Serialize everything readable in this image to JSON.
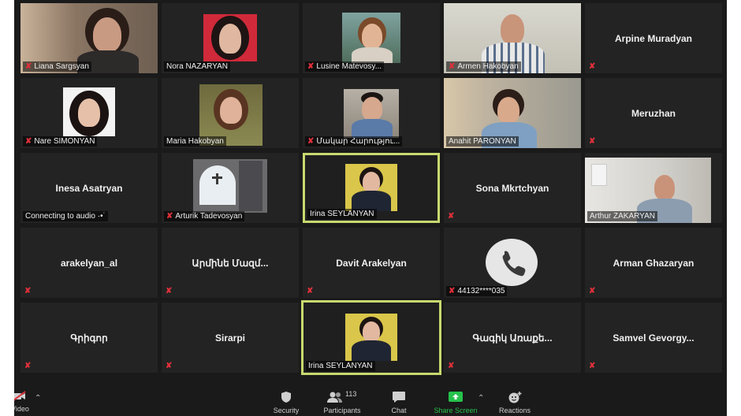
{
  "participants": [
    {
      "name": "Liana Sargsyan",
      "muted": true
    },
    {
      "name": "Nora NAZARYAN",
      "muted": false
    },
    {
      "name": "Lusine Matevosy...",
      "muted": true
    },
    {
      "name": "Armen Hakobyan",
      "muted": true
    },
    {
      "name": "Arpine Muradyan",
      "muted": true
    },
    {
      "name": "Nare SIMONYAN",
      "muted": true
    },
    {
      "name": "Maria Hakobyan",
      "muted": false
    },
    {
      "name": "Մակար Հարությու...",
      "muted": true
    },
    {
      "name": "Anahit PARONYAN",
      "muted": false
    },
    {
      "name": "Meruzhan",
      "muted": true
    },
    {
      "name": "Inesa Asatryan",
      "status": "Connecting to audio",
      "muted": false
    },
    {
      "name": "Arturik Tadevosyan",
      "muted": true
    },
    {
      "name": "Irina SEYLANYAN",
      "muted": false
    },
    {
      "name": "Sona Mkrtchyan",
      "muted": true
    },
    {
      "name": "Arthur ZAKARYAN",
      "muted": false
    },
    {
      "name": "arakelyan_al",
      "muted": true
    },
    {
      "name": "Արմինե Մազմ...",
      "muted": true
    },
    {
      "name": "Davit Arakelyan",
      "muted": true
    },
    {
      "name": "44132****035",
      "muted": true
    },
    {
      "name": "Arman Ghazaryan",
      "muted": true
    },
    {
      "name": "Գրիգոր",
      "muted": true
    },
    {
      "name": "Sirarpi",
      "muted": true
    },
    {
      "name": "Irina SEYLANYAN",
      "muted": false
    },
    {
      "name": "Գագիկ Առաքե...",
      "muted": true
    },
    {
      "name": "Samvel  Gevorgy...",
      "muted": true
    }
  ],
  "toolbar": {
    "video_label": "Video",
    "security_label": "Security",
    "participants_label": "Participants",
    "participants_count": "113",
    "chat_label": "Chat",
    "share_label": "Share Screen",
    "reactions_label": "Reactions"
  },
  "colors": {
    "accent": "#27c24c",
    "active_border": "#c8d96f",
    "mute": "#e0303a"
  }
}
